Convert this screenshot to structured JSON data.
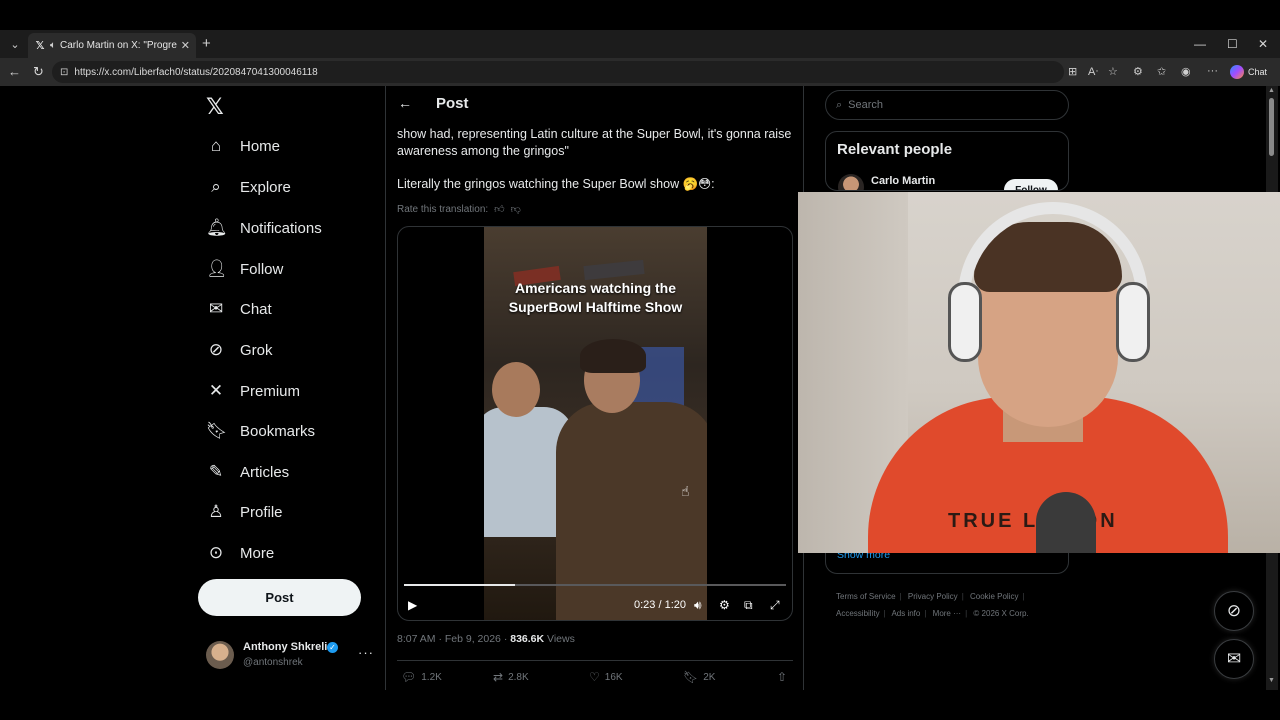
{
  "browser": {
    "tab_title": "Carlo Martin on X: \"Progres",
    "url": "https://x.com/Liberfach0/status/2020847041300046118",
    "chat_label": "Chat"
  },
  "nav": {
    "items": [
      {
        "label": "Home",
        "icon": "home-icon"
      },
      {
        "label": "Explore",
        "icon": "search-icon"
      },
      {
        "label": "Notifications",
        "icon": "bell-icon"
      },
      {
        "label": "Follow",
        "icon": "follow-icon"
      },
      {
        "label": "Chat",
        "icon": "mail-icon"
      },
      {
        "label": "Grok",
        "icon": "grok-icon"
      },
      {
        "label": "Premium",
        "icon": "x-icon"
      },
      {
        "label": "Bookmarks",
        "icon": "bookmark-icon"
      },
      {
        "label": "Articles",
        "icon": "article-icon"
      },
      {
        "label": "Profile",
        "icon": "person-icon"
      },
      {
        "label": "More",
        "icon": "more-icon"
      }
    ],
    "post_button": "Post",
    "account": {
      "name": "Anthony Shkreli",
      "handle": "@antonshrek"
    }
  },
  "post": {
    "header": "Post",
    "text_line1": "show had, representing Latin culture at the Super Bowl, it's gonna raise",
    "text_line2": "awareness among the gringos\"",
    "text_line3": "Literally the gringos watching the Super Bowl show 🥱😳:",
    "rate_translation": "Rate this translation:",
    "video": {
      "caption_line1": "Americans watching the",
      "caption_line2": "SuperBowl Halftime Show",
      "time": "0:23 / 1:20",
      "progress": 0.29
    },
    "timestamp": "8:07 AM · Feb 9, 2026 · ",
    "views_count": "836.6K",
    "views_label": " Views",
    "replies": "1.2K",
    "reposts": "2.8K",
    "likes": "16K",
    "bookmarks": "2K"
  },
  "sidebar": {
    "search_placeholder": "Search",
    "relevant_title": "Relevant people",
    "relevant_name": "Carlo Martin",
    "follow_label": "Follow",
    "show_more": "Show more",
    "footer": {
      "terms": "Terms of Service",
      "privacy": "Privacy Policy",
      "cookie": "Cookie Policy",
      "accessibility": "Accessibility",
      "ads": "Ads info",
      "more": "More ···",
      "copyright": "© 2026 X Corp."
    }
  },
  "webcam": {
    "shirt_text": "TRUE LEGION"
  }
}
